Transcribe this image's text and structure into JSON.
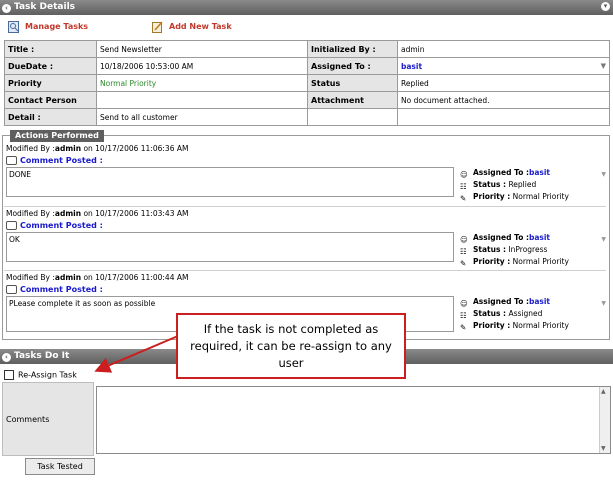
{
  "task_details": {
    "title": "Task Details",
    "manage_tasks": "Manage Tasks",
    "add_new_task": "Add New Task",
    "rows": [
      {
        "l1": "Title :",
        "v1": "Send Newsletter",
        "l2": "Initialized By :",
        "v2": "admin"
      },
      {
        "l1": "DueDate :",
        "v1": "10/18/2006 10:53:00 AM",
        "l2": "Assigned To :",
        "v2": "basit"
      },
      {
        "l1": "Priority",
        "v1": "Normal Priority",
        "l2": "Status",
        "v2": "Replied"
      },
      {
        "l1": "Contact Person",
        "v1": "",
        "l2": "Attachment",
        "v2": "No document attached."
      },
      {
        "l1": "Detail :",
        "v1": "Send to all customer",
        "l2": "",
        "v2": ""
      }
    ]
  },
  "actions": {
    "legend": "Actions Performed",
    "comment_posted": "Comment Posted :",
    "assigned_label": "Assigned To :",
    "status_label": "Status :",
    "priority_label": "Priority :",
    "items": [
      {
        "modified_prefix": "Modified By :",
        "user": "admin",
        "on": "on 10/17/2006 11:06:36 AM",
        "comment": "DONE",
        "assigned": "basit",
        "status": "Replied",
        "priority": "Normal Priority"
      },
      {
        "modified_prefix": "Modified By :",
        "user": "admin",
        "on": "on 10/17/2006 11:03:43 AM",
        "comment": "OK",
        "assigned": "basit",
        "status": "InProgress",
        "priority": "Normal Priority"
      },
      {
        "modified_prefix": "Modified By :",
        "user": "admin",
        "on": "on 10/17/2006 11:00:44 AM",
        "comment": "PLease complete it as soon as possible",
        "assigned": "basit",
        "status": "Assigned",
        "priority": "Normal Priority"
      }
    ]
  },
  "tasks_do_it": {
    "title": "Tasks Do It",
    "reassign_label": "Re-Assign Task",
    "comments_label": "Comments",
    "tested_button": "Task Tested"
  },
  "callout": {
    "text": "If the task is not completed as required, it can be re-assign to any user"
  },
  "colors": {
    "accent_red": "#c0392b",
    "link_blue": "#1a1acc",
    "titlebar": "#6a6a6a",
    "callout_border": "#cc1e1e"
  }
}
